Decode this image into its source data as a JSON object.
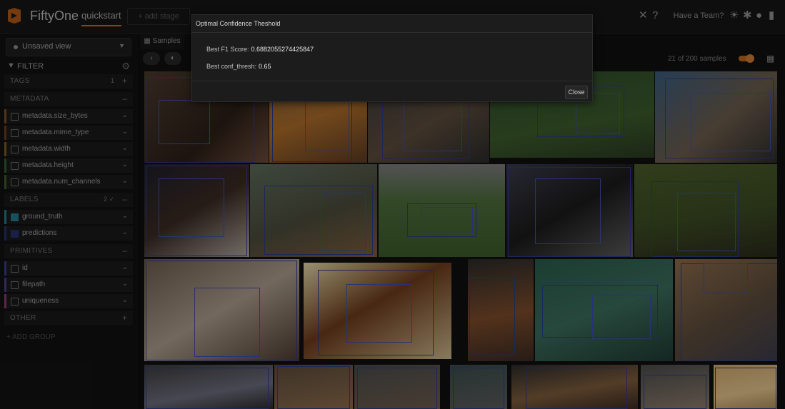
{
  "app": {
    "brand": "FiftyOne",
    "dataset": "quickstart",
    "add_stage": "+ add stage",
    "team_label": "Have a Team?"
  },
  "sidebar": {
    "view_select": "Unsaved view",
    "filter_label": "FILTER",
    "groups": {
      "tags": {
        "name": "TAGS",
        "badge": "1"
      },
      "metadata": {
        "name": "METADATA"
      },
      "labels": {
        "name": "LABELS",
        "badge": "2 ✓"
      },
      "primitives": {
        "name": "PRIMITIVES"
      },
      "other": {
        "name": "OTHER"
      }
    },
    "metadata_fields": [
      "metadata.size_bytes",
      "metadata.mime_type",
      "metadata.width",
      "metadata.height",
      "metadata.num_channels"
    ],
    "label_fields": [
      "ground_truth",
      "predictions"
    ],
    "primitive_fields": [
      "id",
      "filepath",
      "uniqueness"
    ],
    "add_group": "+ ADD GROUP"
  },
  "main": {
    "tab_label": "Samples",
    "sample_count": "21 of 200 samples"
  },
  "modal": {
    "title": "Optimal Confidence Theshold",
    "f1_label": "Best F1 Score:",
    "f1_value": "0.6882055274425847",
    "thresh_label": "Best conf_thresh:",
    "thresh_value": "0.65",
    "close_label": "Close"
  },
  "colors": {
    "accent": "#c7631a",
    "ground_truth": "#24788a",
    "predictions": "#26306a"
  }
}
